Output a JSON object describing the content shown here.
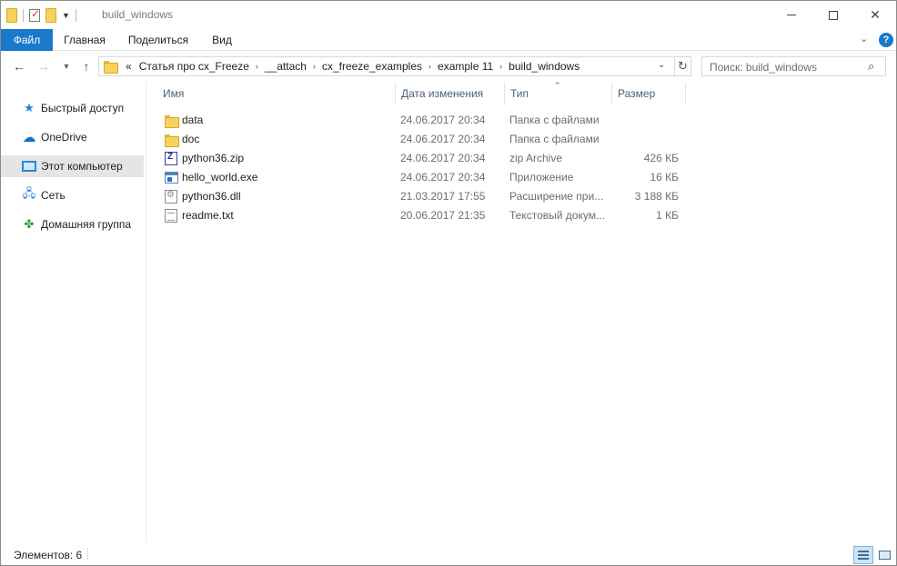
{
  "window": {
    "title": "build_windows",
    "controls": {
      "minimize": "minimize-icon",
      "maximize": "maximize-icon",
      "close": "close-icon"
    }
  },
  "ribbon": {
    "tabs": [
      {
        "label": "Файл",
        "active": true
      },
      {
        "label": "Главная"
      },
      {
        "label": "Поделиться"
      },
      {
        "label": "Вид"
      }
    ],
    "help_label": "?",
    "accent_color": "#1979ca"
  },
  "address_bar": {
    "overflow": "«",
    "crumbs": [
      "Статья про cx_Freeze",
      "__attach",
      "cx_freeze_examples",
      "example 11",
      "build_windows"
    ]
  },
  "search": {
    "placeholder": "Поиск: build_windows"
  },
  "sidebar": {
    "items": [
      {
        "label": "Быстрый доступ",
        "icon": "star-icon"
      },
      {
        "label": "OneDrive",
        "icon": "cloud-icon"
      },
      {
        "label": "Этот компьютер",
        "icon": "computer-icon",
        "selected": true
      },
      {
        "label": "Сеть",
        "icon": "network-icon"
      },
      {
        "label": "Домашняя группа",
        "icon": "homegroup-icon"
      }
    ]
  },
  "columns": {
    "name": "Имя",
    "date": "Дата изменения",
    "type": "Тип",
    "size": "Размер"
  },
  "files": [
    {
      "name": "data",
      "date": "24.06.2017 20:34",
      "type": "Папка с файлами",
      "size": "",
      "icon": "folder-icon"
    },
    {
      "name": "doc",
      "date": "24.06.2017 20:34",
      "type": "Папка с файлами",
      "size": "",
      "icon": "folder-icon"
    },
    {
      "name": "python36.zip",
      "date": "24.06.2017 20:34",
      "type": "zip Archive",
      "size": "426 КБ",
      "icon": "zip-archive-icon"
    },
    {
      "name": "hello_world.exe",
      "date": "24.06.2017 20:34",
      "type": "Приложение",
      "size": "16 КБ",
      "icon": "application-icon"
    },
    {
      "name": "python36.dll",
      "date": "21.03.2017 17:55",
      "type": "Расширение при...",
      "size": "3 188 КБ",
      "icon": "dll-icon"
    },
    {
      "name": "readme.txt",
      "date": "20.06.2017 21:35",
      "type": "Текстовый докум...",
      "size": "1 КБ",
      "icon": "text-file-icon"
    }
  ],
  "status": {
    "items_count": "Элементов: 6"
  }
}
